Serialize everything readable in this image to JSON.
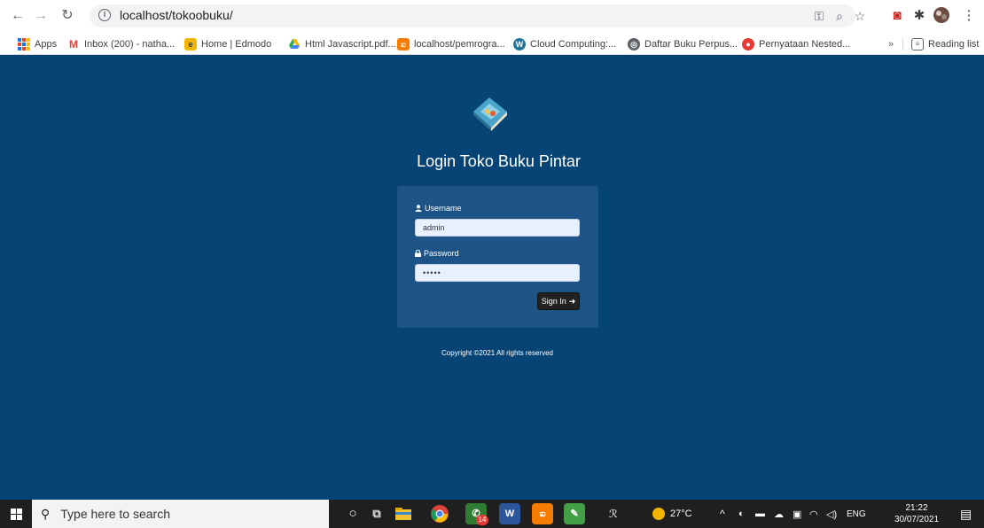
{
  "browser": {
    "url": "localhost/tokoobuku/",
    "bookmarks": [
      {
        "label": "Apps"
      },
      {
        "label": "Inbox (200) - natha..."
      },
      {
        "label": "Home | Edmodo"
      },
      {
        "label": "Html Javascript.pdf..."
      },
      {
        "label": "localhost/pemrogra..."
      },
      {
        "label": "Cloud Computing:..."
      },
      {
        "label": "Daftar Buku Perpus..."
      },
      {
        "label": "Pernyataan Nested..."
      }
    ],
    "more_bookmarks": "»",
    "reading_list": "Reading list"
  },
  "login": {
    "title": "Login Toko Buku Pintar",
    "username_label": "Username",
    "username_value": "admin",
    "password_label": "Password",
    "password_value": "•••••",
    "signin_label": "Sign In",
    "copyright": "Copyright ©2021 All rights reserved"
  },
  "taskbar": {
    "search_placeholder": "Type here to search",
    "chrome_badge": "14",
    "weather": "27°C",
    "language": "ENG",
    "time": "21:22",
    "date": "30/07/2021"
  },
  "colors": {
    "page_bg": "#064476",
    "login_box": "#1d5487",
    "signin_btn": "#222222"
  }
}
